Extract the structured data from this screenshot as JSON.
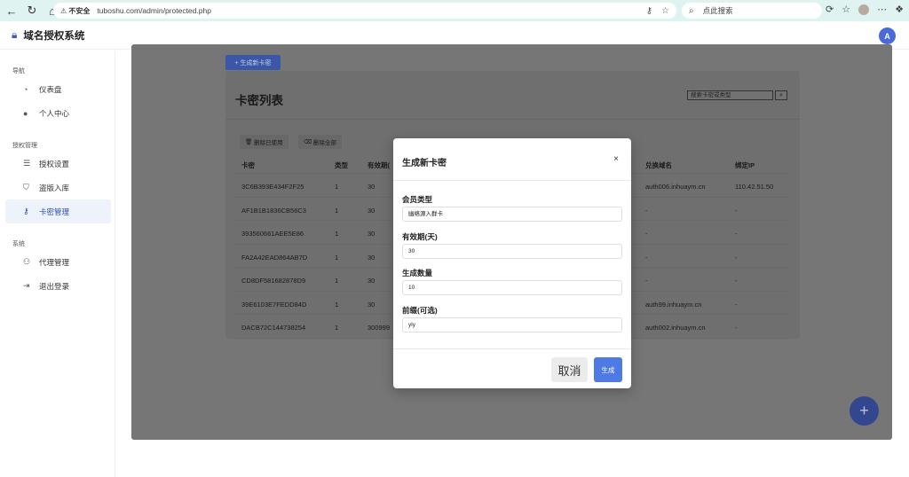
{
  "browser": {
    "back": "←",
    "reload": "↻",
    "home": "⌂",
    "insecure_label": "不安全",
    "url": "tuboshu.com/admin/protected.php",
    "search_placeholder": "点此搜索"
  },
  "app": {
    "title": "域名授权系统",
    "avatar_initial": "A"
  },
  "sidebar": {
    "sections": [
      {
        "title": "导航",
        "items": [
          {
            "label": "仪表盘",
            "icon": "pie-chart-icon"
          },
          {
            "label": "个人中心",
            "icon": "user-icon"
          }
        ]
      },
      {
        "title": "授权管理",
        "items": [
          {
            "label": "授权设置",
            "icon": "sliders-icon"
          },
          {
            "label": "盗版入库",
            "icon": "shield-icon"
          },
          {
            "label": "卡密管理",
            "icon": "key-icon",
            "active": true
          }
        ]
      },
      {
        "title": "系统",
        "items": [
          {
            "label": "代理管理",
            "icon": "users-icon"
          },
          {
            "label": "退出登录",
            "icon": "logout-icon"
          }
        ]
      }
    ]
  },
  "main": {
    "new_button": "+ 生成新卡密",
    "card_title": "卡密列表",
    "search_placeholder": "搜索卡密或类型",
    "delete_used": "删除已使用",
    "delete_all": "删除全部",
    "columns": [
      "卡密",
      "类型",
      "有效期(",
      "兑换域名",
      "绑定IP"
    ],
    "rows": [
      {
        "code": "3C6B393E434F2F25",
        "type": "1",
        "days": "30",
        "domain": "auth006.inhuaym.cn",
        "ip": "110.42.51.50"
      },
      {
        "code": "AF1B1B1836CB56C3",
        "type": "1",
        "days": "30",
        "domain": "-",
        "ip": "-"
      },
      {
        "code": "393560661AEE5E86",
        "type": "1",
        "days": "30",
        "domain": "-",
        "ip": "-"
      },
      {
        "code": "FA2A42EAD864AB7D",
        "type": "1",
        "days": "30",
        "domain": "-",
        "ip": "-"
      },
      {
        "code": "CD8DF581682878D9",
        "type": "1",
        "days": "30",
        "domain": "-",
        "ip": "-"
      },
      {
        "code": "39E6103E7FEDD84D",
        "type": "1",
        "days": "30",
        "domain": "auth99.inhuaym.cn",
        "ip": "-"
      },
      {
        "code": "DACB72C144738254",
        "type": "1",
        "days": "300999",
        "domain": "auth002.inhuaym.cn",
        "ip": "-"
      }
    ],
    "fab": "+"
  },
  "modal": {
    "title": "生成新卡密",
    "close": "×",
    "fields": [
      {
        "label": "会员类型",
        "value": "幽络源入群卡"
      },
      {
        "label": "有效期(天)",
        "value": "30"
      },
      {
        "label": "生成数量",
        "value": "10"
      },
      {
        "label": "前缀(可选)",
        "value": "yly"
      }
    ],
    "cancel": "取消",
    "submit": "生成"
  },
  "colors": {
    "accent": "#4e7ae6",
    "brand": "#3b5bc0",
    "browser_frame": "#5ec7b9"
  }
}
